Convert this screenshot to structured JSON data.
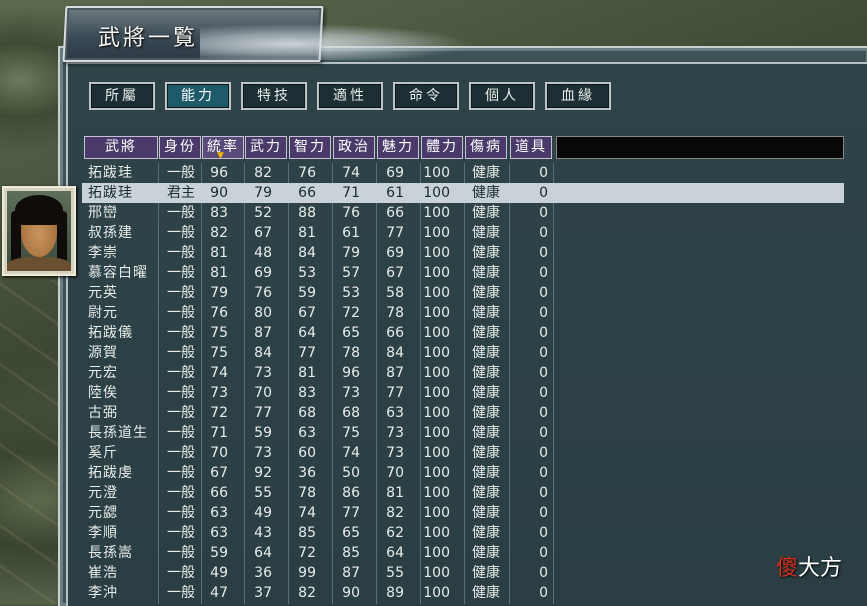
{
  "window": {
    "title": "武將一覧"
  },
  "tabs": [
    {
      "label": "所屬",
      "active": false
    },
    {
      "label": "能力",
      "active": true
    },
    {
      "label": "特技",
      "active": false
    },
    {
      "label": "適性",
      "active": false
    },
    {
      "label": "命令",
      "active": false
    },
    {
      "label": "個人",
      "active": false
    },
    {
      "label": "血緣",
      "active": false
    }
  ],
  "table": {
    "columns": [
      "武將",
      "身份",
      "統率",
      "武力",
      "智力",
      "政治",
      "魅力",
      "體力",
      "傷病",
      "道具"
    ],
    "sorted_column": "統率",
    "selected_row": 1,
    "rows": [
      [
        "拓跋珪",
        "一般",
        "96",
        "82",
        "76",
        "74",
        "69",
        "100",
        "健康",
        "0"
      ],
      [
        "拓跋珪",
        "君主",
        "90",
        "79",
        "66",
        "71",
        "61",
        "100",
        "健康",
        "0"
      ],
      [
        "邢巒",
        "一般",
        "83",
        "52",
        "88",
        "76",
        "66",
        "100",
        "健康",
        "0"
      ],
      [
        "叔孫建",
        "一般",
        "82",
        "67",
        "81",
        "61",
        "77",
        "100",
        "健康",
        "0"
      ],
      [
        "李崇",
        "一般",
        "81",
        "48",
        "84",
        "79",
        "69",
        "100",
        "健康",
        "0"
      ],
      [
        "慕容白曜",
        "一般",
        "81",
        "69",
        "53",
        "57",
        "67",
        "100",
        "健康",
        "0"
      ],
      [
        "元英",
        "一般",
        "79",
        "76",
        "59",
        "53",
        "58",
        "100",
        "健康",
        "0"
      ],
      [
        "尉元",
        "一般",
        "76",
        "80",
        "67",
        "72",
        "78",
        "100",
        "健康",
        "0"
      ],
      [
        "拓跋儀",
        "一般",
        "75",
        "87",
        "64",
        "65",
        "66",
        "100",
        "健康",
        "0"
      ],
      [
        "源賀",
        "一般",
        "75",
        "84",
        "77",
        "78",
        "84",
        "100",
        "健康",
        "0"
      ],
      [
        "元宏",
        "一般",
        "74",
        "73",
        "81",
        "96",
        "87",
        "100",
        "健康",
        "0"
      ],
      [
        "陸俟",
        "一般",
        "73",
        "70",
        "83",
        "73",
        "77",
        "100",
        "健康",
        "0"
      ],
      [
        "古弼",
        "一般",
        "72",
        "77",
        "68",
        "68",
        "63",
        "100",
        "健康",
        "0"
      ],
      [
        "長孫道生",
        "一般",
        "71",
        "59",
        "63",
        "75",
        "73",
        "100",
        "健康",
        "0"
      ],
      [
        "奚斤",
        "一般",
        "70",
        "73",
        "60",
        "74",
        "73",
        "100",
        "健康",
        "0"
      ],
      [
        "拓跋虔",
        "一般",
        "67",
        "92",
        "36",
        "50",
        "70",
        "100",
        "健康",
        "0"
      ],
      [
        "元澄",
        "一般",
        "66",
        "55",
        "78",
        "86",
        "81",
        "100",
        "健康",
        "0"
      ],
      [
        "元勰",
        "一般",
        "63",
        "49",
        "74",
        "77",
        "82",
        "100",
        "健康",
        "0"
      ],
      [
        "李順",
        "一般",
        "63",
        "43",
        "85",
        "65",
        "62",
        "100",
        "健康",
        "0"
      ],
      [
        "長孫嵩",
        "一般",
        "59",
        "64",
        "72",
        "85",
        "64",
        "100",
        "健康",
        "0"
      ],
      [
        "崔浩",
        "一般",
        "49",
        "36",
        "99",
        "87",
        "55",
        "100",
        "健康",
        "0"
      ],
      [
        "李沖",
        "一般",
        "47",
        "37",
        "82",
        "90",
        "89",
        "100",
        "健康",
        "0"
      ]
    ]
  },
  "watermark": {
    "accent": "傻",
    "rest": "大方"
  }
}
